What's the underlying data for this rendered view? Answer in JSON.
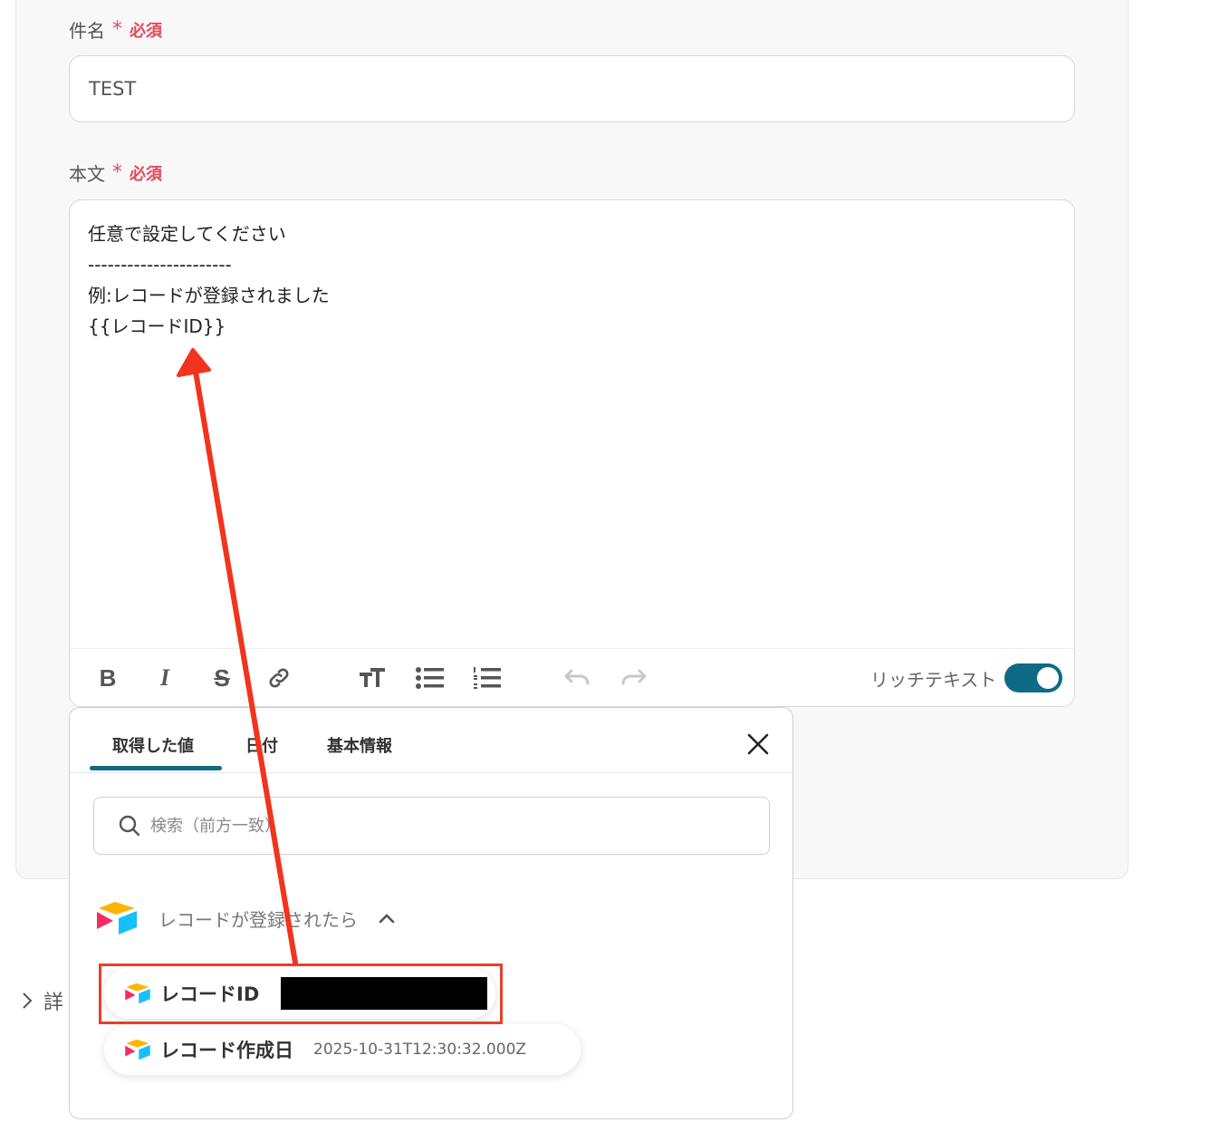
{
  "form": {
    "subject": {
      "label": "件名",
      "required_mark": "*",
      "required_text": "必須",
      "value": "TEST"
    },
    "body": {
      "label": "本文",
      "required_mark": "*",
      "required_text": "必須",
      "lines": [
        "任意で設定してください",
        "----------------------",
        "例:レコードが登録されました",
        "{{レコードID}}"
      ]
    },
    "toolbar": {
      "bold": "B",
      "italic": "I",
      "strike": "S",
      "rich_text_label": "リッチテキスト",
      "rich_text_enabled": true
    }
  },
  "details": {
    "label": "詳"
  },
  "popup": {
    "tabs": [
      {
        "label": "取得した値",
        "active": true
      },
      {
        "label": "日付",
        "active": false
      },
      {
        "label": "基本情報",
        "active": false
      }
    ],
    "search_placeholder": "検索（前方一致）",
    "group": {
      "title": "レコードが登録されたら",
      "expanded": true
    },
    "items": [
      {
        "label": "レコードID",
        "value": "",
        "redacted": true,
        "highlighted": true
      },
      {
        "label": "レコード作成日",
        "value": "2025-10-31T12:30:32.000Z",
        "redacted": false
      }
    ]
  },
  "colors": {
    "accent": "#0f6b85",
    "required": "#e24a5a",
    "annotation": "#e8402f"
  },
  "icons": {
    "close": "close-icon",
    "search": "search-icon",
    "chevron": "chevron-up-icon",
    "airtable": "airtable-logo-icon",
    "details": "chevron-right-icon"
  }
}
